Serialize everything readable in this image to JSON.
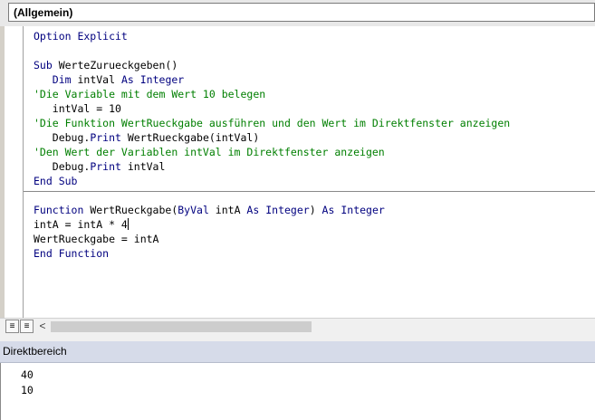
{
  "object_combo": {
    "value": "(Allgemein)"
  },
  "code_lines": [
    {
      "segments": [
        {
          "t": "kw",
          "s": "Option Explicit"
        }
      ]
    },
    {
      "segments": []
    },
    {
      "segments": [
        {
          "t": "kw",
          "s": "Sub"
        },
        {
          "t": "tx",
          "s": " WerteZurueckgeben()"
        }
      ]
    },
    {
      "segments": [
        {
          "t": "tx",
          "s": "   "
        },
        {
          "t": "kw",
          "s": "Dim"
        },
        {
          "t": "tx",
          "s": " intVal "
        },
        {
          "t": "kw",
          "s": "As"
        },
        {
          "t": "tx",
          "s": " "
        },
        {
          "t": "kw",
          "s": "Integer"
        }
      ]
    },
    {
      "segments": [
        {
          "t": "cm",
          "s": "'Die Variable mit dem Wert 10 belegen"
        }
      ]
    },
    {
      "segments": [
        {
          "t": "tx",
          "s": "   intVal = 10"
        }
      ]
    },
    {
      "segments": [
        {
          "t": "cm",
          "s": "'Die Funktion WertRueckgabe ausführen und den Wert im Direktfenster anzeigen"
        }
      ]
    },
    {
      "segments": [
        {
          "t": "tx",
          "s": "   Debug."
        },
        {
          "t": "kw",
          "s": "Print"
        },
        {
          "t": "tx",
          "s": " WertRueckgabe(intVal)"
        }
      ]
    },
    {
      "segments": [
        {
          "t": "cm",
          "s": "'Den Wert der Variablen intVal im Direktfenster anzeigen"
        }
      ]
    },
    {
      "segments": [
        {
          "t": "tx",
          "s": "   Debug."
        },
        {
          "t": "kw",
          "s": "Print"
        },
        {
          "t": "tx",
          "s": " intVal"
        }
      ]
    },
    {
      "segments": [
        {
          "t": "kw",
          "s": "End Sub"
        }
      ]
    },
    {
      "segments": []
    },
    {
      "segments": [
        {
          "t": "kw",
          "s": "Function"
        },
        {
          "t": "tx",
          "s": " WertRueckgabe("
        },
        {
          "t": "kw",
          "s": "ByVal"
        },
        {
          "t": "tx",
          "s": " intA "
        },
        {
          "t": "kw",
          "s": "As"
        },
        {
          "t": "tx",
          "s": " "
        },
        {
          "t": "kw",
          "s": "Integer"
        },
        {
          "t": "tx",
          "s": ") "
        },
        {
          "t": "kw",
          "s": "As"
        },
        {
          "t": "tx",
          "s": " "
        },
        {
          "t": "kw",
          "s": "Integer"
        }
      ]
    },
    {
      "segments": [
        {
          "t": "tx",
          "s": "intA = intA * 4"
        }
      ],
      "caret": true
    },
    {
      "segments": [
        {
          "t": "tx",
          "s": "WertRueckgabe = intA"
        }
      ]
    },
    {
      "segments": [
        {
          "t": "kw",
          "s": "End Function"
        }
      ]
    }
  ],
  "procedure_separator_after": [
    10
  ],
  "scroll_left_glyph": "<",
  "immediate": {
    "title": "Direktbereich",
    "output": [
      "40",
      "10"
    ]
  },
  "colors": {
    "keyword": "#00007f",
    "comment": "#007f00",
    "text": "#000000"
  },
  "icons": {
    "procedure_view": "procedure-view-icon",
    "full_module_view": "full-module-view-icon"
  }
}
